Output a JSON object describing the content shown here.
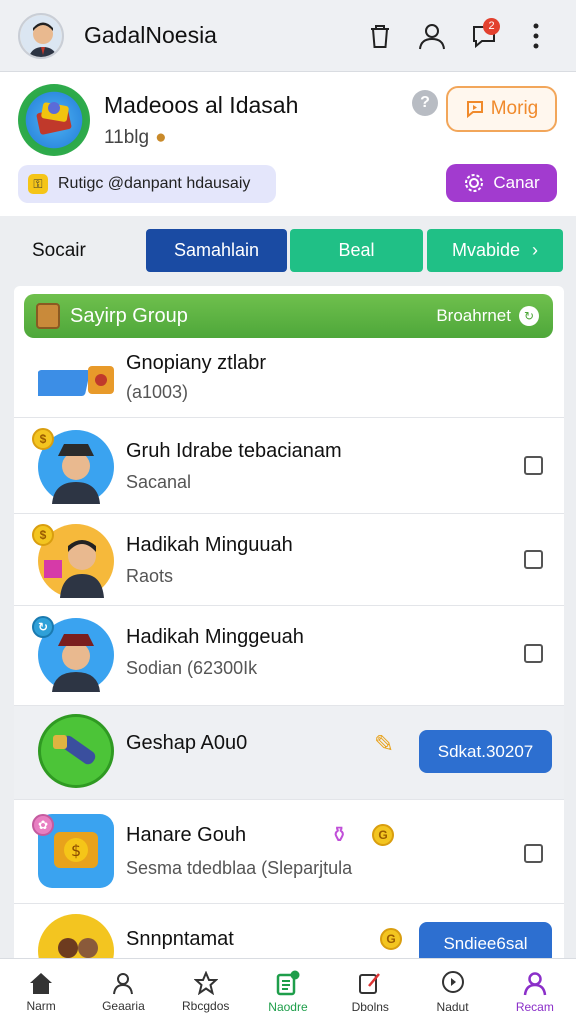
{
  "app": {
    "title": "GadalNoesia"
  },
  "profile": {
    "name": "Madeoos al Idasah",
    "sub": "11blg",
    "more_label": "Morig",
    "chip_label": "Rutigc @danpant hdausaiy",
    "cancel_label": "Canar"
  },
  "filter": {
    "label": "Socair",
    "tabs": [
      "Samahlain",
      "Beal",
      "Mvabide"
    ]
  },
  "group": {
    "title": "Sayirp Group",
    "right_label": "Broahrnet"
  },
  "rows": [
    {
      "title": "Gnopiany ztlabr",
      "sub": "(a1003)"
    },
    {
      "title": "Gruh Idrabe tebacianam",
      "sub": "Sacanal"
    },
    {
      "title": "Hadikah Minguuah",
      "sub": "Raots"
    },
    {
      "title": "Hadikah Minggeuah",
      "sub": "Sodian (62300Ik"
    },
    {
      "title": "Geshap A0u0",
      "pill": "Sdkat.30207"
    },
    {
      "title": "Hanare Gouh",
      "sub": "Sesma tdedblaa (Sleparjtula"
    },
    {
      "title": "Snnpntamat",
      "pill": "Sndiee6sal"
    }
  ],
  "nav": [
    "Narm",
    "Geaaria",
    "Rbcgdos",
    "Naodre",
    "Dbolns",
    "Nadut",
    "Recam"
  ],
  "colors": {
    "primary": "#1a4ba3",
    "teal": "#20c086",
    "purple": "#a23bcf",
    "orange": "#f08a2c",
    "green": "#4ea73a",
    "blue_pill": "#2d6fd0"
  }
}
